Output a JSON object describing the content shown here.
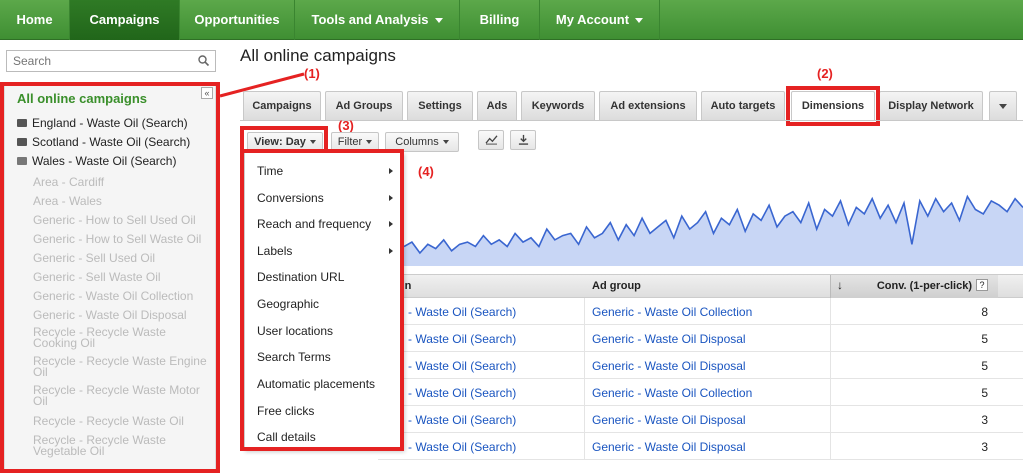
{
  "nav": {
    "items": [
      {
        "label": "Home"
      },
      {
        "label": "Campaigns"
      },
      {
        "label": "Opportunities"
      },
      {
        "label": "Tools and Analysis"
      },
      {
        "label": "Billing"
      },
      {
        "label": "My Account"
      }
    ],
    "active_index": 1,
    "colors": {
      "bar": "#4c9a3e",
      "active": "#2a7020"
    }
  },
  "search": {
    "placeholder": "Search"
  },
  "sidebar": {
    "title": "All online campaigns",
    "campaigns": [
      {
        "label": "England - Waste Oil (Search)"
      },
      {
        "label": "Scotland - Waste Oil (Search)"
      },
      {
        "label": "Wales - Waste Oil (Search)"
      }
    ],
    "ad_groups": [
      {
        "label": "Area - Cardiff"
      },
      {
        "label": "Area - Wales"
      },
      {
        "label": "Generic - How to Sell Used Oil"
      },
      {
        "label": "Generic - How to Sell Waste Oil"
      },
      {
        "label": "Generic - Sell Used Oil"
      },
      {
        "label": "Generic - Sell Waste Oil"
      },
      {
        "label": "Generic - Waste Oil Collection"
      },
      {
        "label": "Generic - Waste Oil Disposal"
      },
      {
        "label": "Recycle - Recycle Waste Cooking Oil"
      },
      {
        "label": "Recycle - Recycle Waste Engine Oil"
      },
      {
        "label": "Recycle - Recycle Waste Motor Oil"
      },
      {
        "label": "Recycle - Recycle Waste Oil"
      },
      {
        "label": "Recycle - Recycle Waste Vegetable Oil"
      }
    ]
  },
  "page": {
    "title": "All online campaigns"
  },
  "tabs": [
    {
      "label": "Campaigns"
    },
    {
      "label": "Ad Groups"
    },
    {
      "label": "Settings"
    },
    {
      "label": "Ads"
    },
    {
      "label": "Keywords"
    },
    {
      "label": "Ad extensions"
    },
    {
      "label": "Auto targets"
    },
    {
      "label": "Dimensions"
    },
    {
      "label": "Display Network"
    }
  ],
  "active_tab": "Dimensions",
  "toolbar": {
    "view": "View: Day",
    "filter": "Filter",
    "columns": "Columns"
  },
  "annotations": {
    "a1": "(1)",
    "a2": "(2)",
    "a3": "(3)",
    "a4": "(4)"
  },
  "view_menu": [
    {
      "label": "Time",
      "submenu": true
    },
    {
      "label": "Conversions",
      "submenu": true
    },
    {
      "label": "Reach and frequency",
      "submenu": true
    },
    {
      "label": "Labels",
      "submenu": true
    },
    {
      "label": "Destination URL",
      "submenu": false
    },
    {
      "label": "Geographic",
      "submenu": false
    },
    {
      "label": "User locations",
      "submenu": false
    },
    {
      "label": "Search Terms",
      "submenu": false
    },
    {
      "label": "Automatic placements",
      "submenu": false
    },
    {
      "label": "Free clicks",
      "submenu": false
    },
    {
      "label": "Call details",
      "submenu": false
    }
  ],
  "table": {
    "headers": {
      "campaign": "paign",
      "ad_group": "Ad group",
      "conv": "Conv. (1-per-click)",
      "help": "?"
    },
    "rows": [
      {
        "campaign": "land - Waste Oil (Search)",
        "ad_group": "Generic - Waste Oil Collection",
        "conv": "8"
      },
      {
        "campaign": "land - Waste Oil (Search)",
        "ad_group": "Generic - Waste Oil Disposal",
        "conv": "5"
      },
      {
        "campaign": "land - Waste Oil (Search)",
        "ad_group": "Generic - Waste Oil Disposal",
        "conv": "5"
      },
      {
        "campaign": "land - Waste Oil (Search)",
        "ad_group": "Generic - Waste Oil Collection",
        "conv": "5"
      },
      {
        "campaign": "land - Waste Oil (Search)",
        "ad_group": "Generic - Waste Oil Disposal",
        "conv": "3"
      },
      {
        "campaign": "land - Waste Oil (Search)",
        "ad_group": "Generic - Waste Oil Disposal",
        "conv": "3"
      }
    ]
  },
  "sparkline": {
    "color": "#3a66d0",
    "fill": "#c8d6f5",
    "values": [
      18,
      22,
      12,
      20,
      16,
      24,
      14,
      20,
      22,
      18,
      28,
      20,
      24,
      18,
      30,
      22,
      26,
      18,
      34,
      24,
      28,
      30,
      20,
      36,
      26,
      30,
      40,
      24,
      38,
      28,
      44,
      30,
      36,
      42,
      26,
      46,
      34,
      40,
      50,
      30,
      44,
      38,
      52,
      32,
      48,
      42,
      56,
      36,
      46,
      50,
      40,
      58,
      34,
      52,
      46,
      60,
      38,
      54,
      48,
      62,
      44,
      56,
      40,
      58,
      20,
      60,
      46,
      62,
      50,
      58,
      42,
      64,
      52,
      48,
      60,
      56,
      50,
      62,
      54
    ]
  }
}
